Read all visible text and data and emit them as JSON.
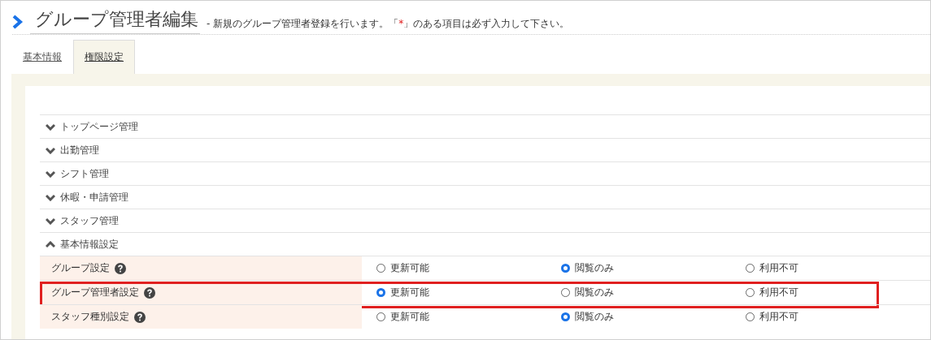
{
  "header": {
    "title": "グループ管理者編集",
    "subtitle_before": "- 新規のグループ管理者登録を行います。「",
    "required_mark": "*",
    "subtitle_after": "」のある項目は必ず入力して下さい。"
  },
  "tabs": [
    {
      "label": "基本情報",
      "selected": false
    },
    {
      "label": "権限設定",
      "selected": true
    }
  ],
  "sections": [
    {
      "label": "トップページ管理",
      "expanded": false
    },
    {
      "label": "出勤管理",
      "expanded": false
    },
    {
      "label": "シフト管理",
      "expanded": false
    },
    {
      "label": "休暇・申請管理",
      "expanded": false
    },
    {
      "label": "スタッフ管理",
      "expanded": false
    },
    {
      "label": "基本情報設定",
      "expanded": true,
      "rows": [
        {
          "label": "グループ設定",
          "highlighted": false,
          "options": [
            {
              "label": "更新可能",
              "selected": false
            },
            {
              "label": "閲覧のみ",
              "selected": true
            },
            {
              "label": "利用不可",
              "selected": false
            }
          ]
        },
        {
          "label": "グループ管理者設定",
          "highlighted": true,
          "options": [
            {
              "label": "更新可能",
              "selected": true
            },
            {
              "label": "閲覧のみ",
              "selected": false
            },
            {
              "label": "利用不可",
              "selected": false
            }
          ]
        },
        {
          "label": "スタッフ種別設定",
          "highlighted": false,
          "options": [
            {
              "label": "更新可能",
              "selected": false
            },
            {
              "label": "閲覧のみ",
              "selected": true
            },
            {
              "label": "利用不可",
              "selected": false
            }
          ]
        }
      ]
    }
  ]
}
